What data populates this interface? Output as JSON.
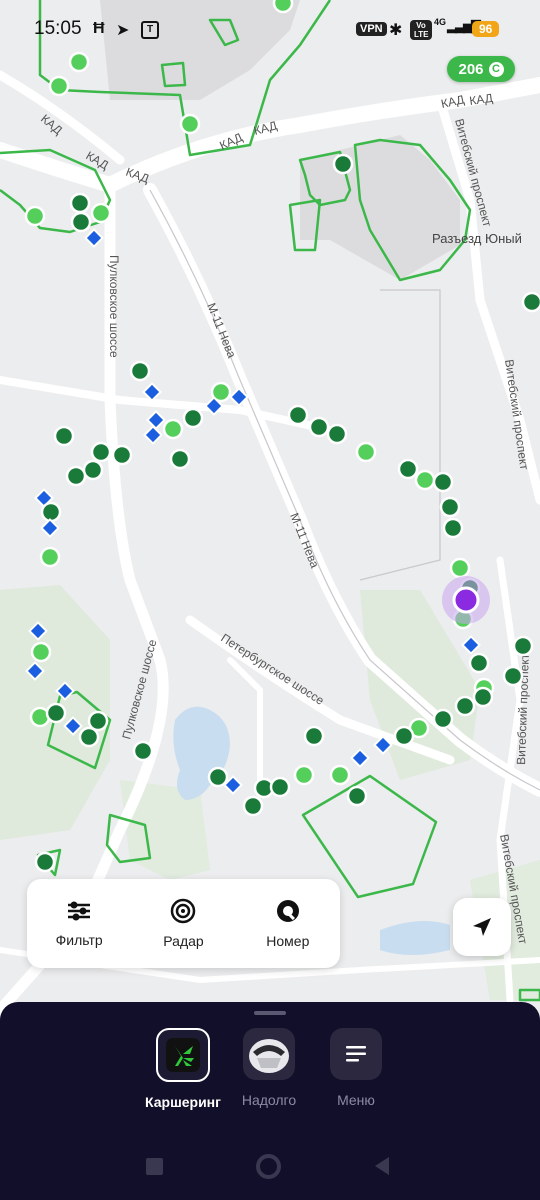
{
  "status_bar": {
    "time": "15:05",
    "vpn_label": "VPN",
    "volte_label": "Vo LTE",
    "network_label": "4G",
    "battery_level": "96",
    "icons": [
      "notification-h-icon",
      "telegram-icon",
      "app-t-icon",
      "bluetooth-icon",
      "signal-icon",
      "battery-icon"
    ]
  },
  "balance": {
    "value": "206",
    "currency_symbol": "C"
  },
  "map_labels": {
    "kad1": "КАД",
    "kad2": "КАД",
    "kad3": "КАД",
    "kad4": "КАД",
    "kad5": "КАД",
    "kad6": "КАД",
    "kad7": "КАД",
    "vitebsky1": "Витебский проспект",
    "vitebsky2": "Витебский проспект",
    "vitebsky3": "Витебский проспект",
    "vitebsky4": "Витебский проспект",
    "razezd": "Разъезд Юный",
    "pulkovskoe1": "Пулковское шоссе",
    "pulkovskoe2": "Пулковское шоссе",
    "m11a": "М-11 Нева",
    "m11b": "М-11 Нева",
    "peterburgskoe": "Петербургское шоссе"
  },
  "tools": [
    {
      "label": "Фильтр",
      "icon": "filter-sliders-icon"
    },
    {
      "label": "Радар",
      "icon": "radar-icon"
    },
    {
      "label": "Номер",
      "icon": "search-number-icon"
    }
  ],
  "bottom_nav": [
    {
      "label": "Каршеринг",
      "icon": "carsharing-logo-icon",
      "active": true
    },
    {
      "label": "Надолго",
      "icon": "car-front-icon",
      "active": false
    },
    {
      "label": "Меню",
      "icon": "menu-icon",
      "active": false
    }
  ],
  "colors": {
    "marker_light": "#54cf5c",
    "marker_dark": "#1a7a3a",
    "marker_blue": "#1b5fe0",
    "user": "#8a2be2",
    "zone_border": "#3cb84a",
    "sheet_bg": "#120f2a"
  }
}
